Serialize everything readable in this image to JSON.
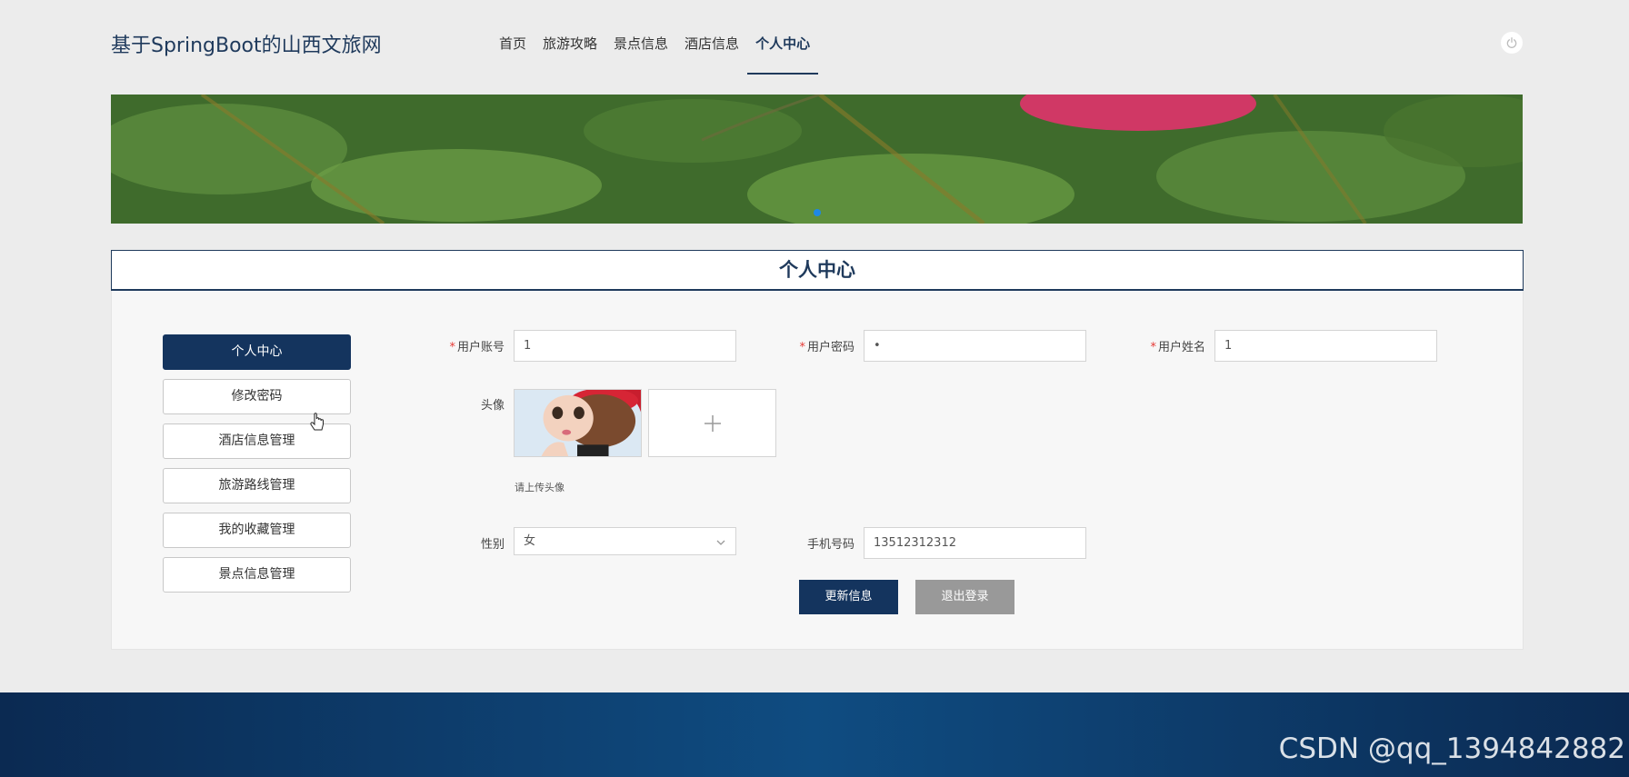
{
  "site_title": "基于SpringBoot的山西文旅网",
  "nav": {
    "items": [
      "首页",
      "旅游攻略",
      "景点信息",
      "酒店信息",
      "个人中心"
    ],
    "active_index": 4
  },
  "section_title": "个人中心",
  "sidebar": {
    "items": [
      "个人中心",
      "修改密码",
      "酒店信息管理",
      "旅游路线管理",
      "我的收藏管理",
      "景点信息管理"
    ],
    "active_index": 0
  },
  "form": {
    "account": {
      "label": "用户账号",
      "value": "1",
      "required": true
    },
    "password": {
      "label": "用户密码",
      "value": "•",
      "required": true
    },
    "name": {
      "label": "用户姓名",
      "value": "1",
      "required": true
    },
    "avatar": {
      "label": "头像",
      "hint": "请上传头像"
    },
    "gender": {
      "label": "性别",
      "value": "女"
    },
    "phone": {
      "label": "手机号码",
      "value": "13512312312"
    }
  },
  "buttons": {
    "update": "更新信息",
    "logout": "退出登录"
  },
  "watermark": "CSDN @qq_1394842882",
  "colors": {
    "primary": "#14345e",
    "required": "#e53935",
    "logout_btn": "#999999"
  }
}
